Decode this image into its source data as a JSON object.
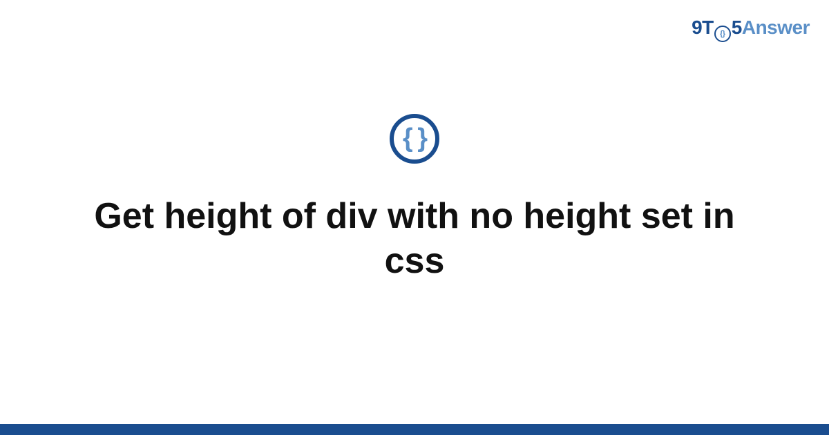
{
  "logo": {
    "part1": "9T",
    "circle_inner": "{}",
    "part2": "5",
    "part3": "Answer"
  },
  "icon": {
    "braces": "{ }"
  },
  "title": "Get height of div with no height set in css",
  "colors": {
    "brand_dark": "#1a4d8f",
    "brand_light": "#5a8fc7"
  }
}
